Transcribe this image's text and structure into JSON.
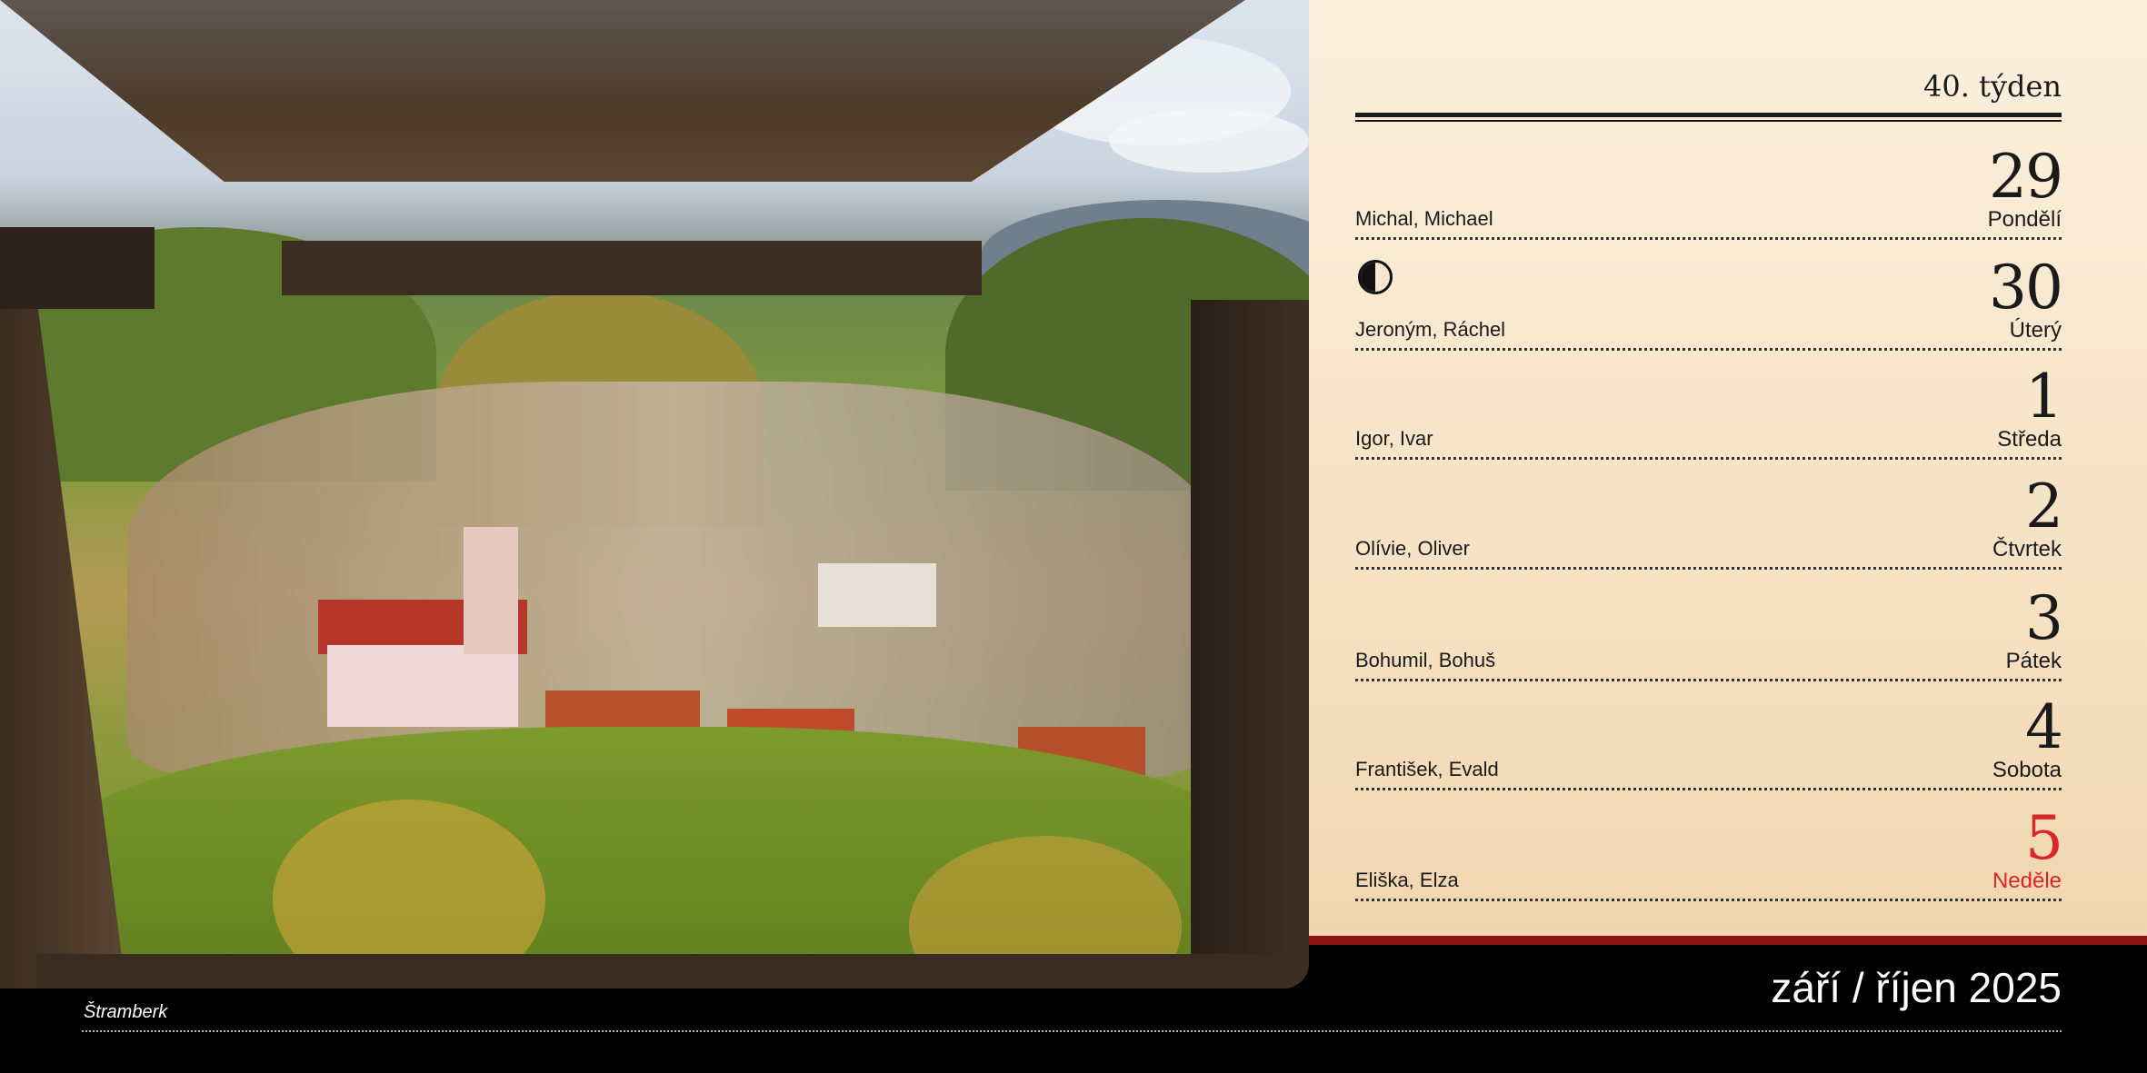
{
  "photo": {
    "caption": "Štramberk"
  },
  "calendar": {
    "week_label": "40. týden",
    "month_title": "září / říjen 2025",
    "days": [
      {
        "num": "29",
        "weekday": "Pondělí",
        "names": "Michal, Michael"
      },
      {
        "num": "30",
        "weekday": "Úterý",
        "names": "Jeroným, Ráchel",
        "icon": "moon-phase-icon"
      },
      {
        "num": "1",
        "weekday": "Středa",
        "names": "Igor, Ivar"
      },
      {
        "num": "2",
        "weekday": "Čtvrtek",
        "names": "Olívie, Oliver"
      },
      {
        "num": "3",
        "weekday": "Pátek",
        "names": "Bohumil, Bohuš"
      },
      {
        "num": "4",
        "weekday": "Sobota",
        "names": "František, Evald"
      },
      {
        "num": "5",
        "weekday": "Neděle",
        "names": "Eliška, Elza"
      }
    ]
  },
  "colors": {
    "sunday": "#d8262a",
    "accent_line": "#8a1414",
    "panel_bg": "#f6e2c4"
  }
}
